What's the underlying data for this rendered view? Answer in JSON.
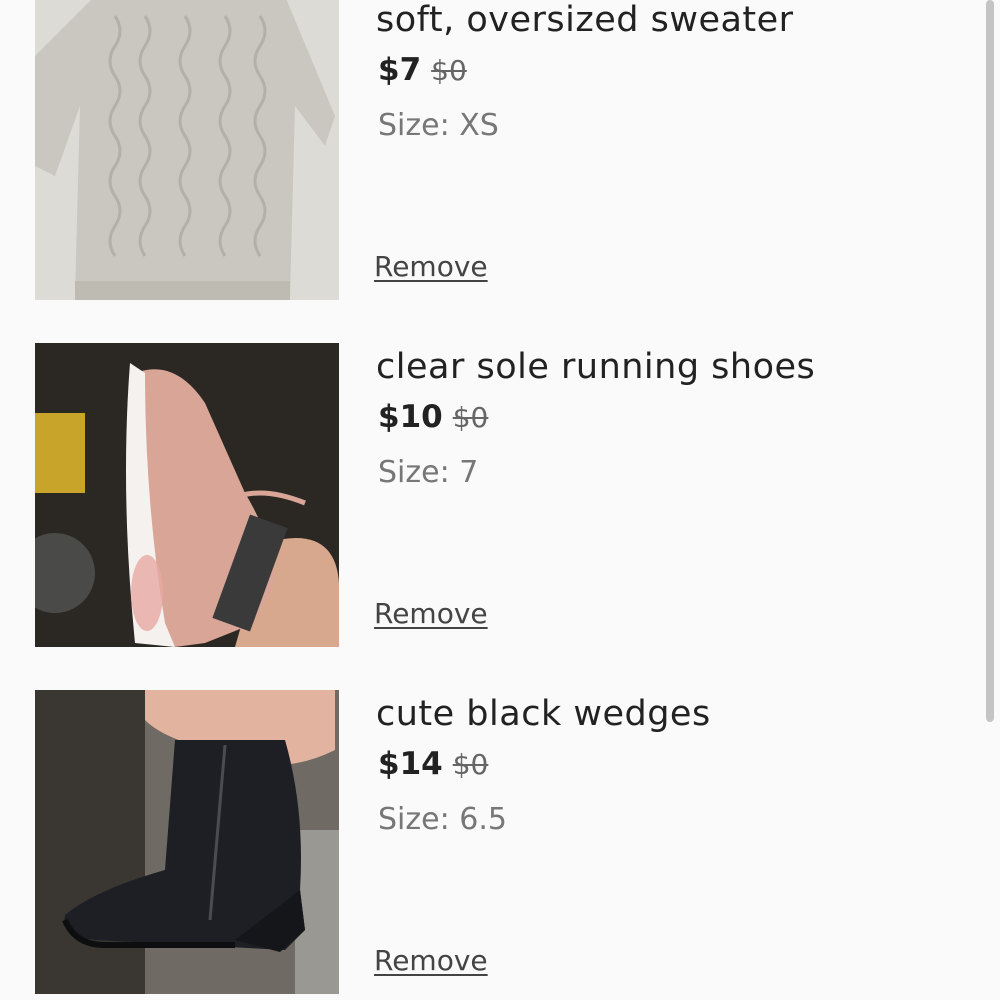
{
  "cart": {
    "items": [
      {
        "title": "soft, oversized sweater",
        "price": "$7",
        "original_price": "$0",
        "size": "Size: XS",
        "remove_label": "Remove",
        "image": "cream cable-knit sweater photo"
      },
      {
        "title": "clear sole running shoes",
        "price": "$10",
        "original_price": "$0",
        "size": "Size: 7",
        "remove_label": "Remove",
        "image": "pink running shoe with clear sole photo"
      },
      {
        "title": "cute black wedges",
        "price": "$14",
        "original_price": "$0",
        "size": "Size: 6.5",
        "remove_label": "Remove",
        "image": "black suede wedge bootie photo"
      }
    ]
  },
  "colors": {
    "background": "#fafafa",
    "text": "#222222",
    "muted_text": "#777777"
  }
}
